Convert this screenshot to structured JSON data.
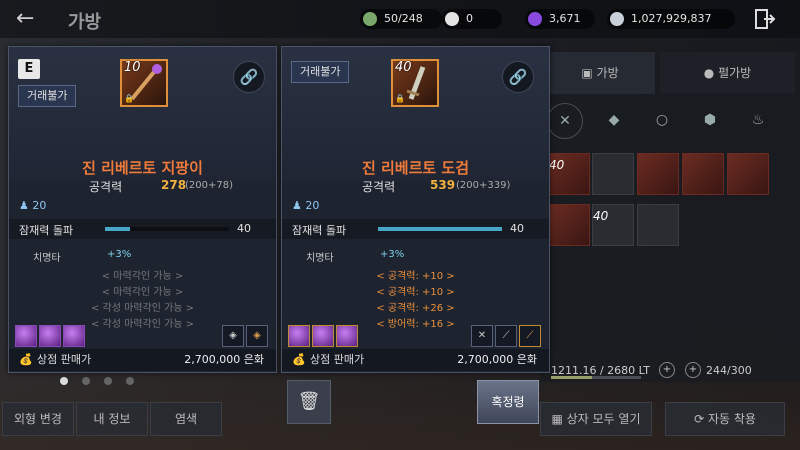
{
  "header": {
    "back": "←",
    "title": "가방"
  },
  "currencies": [
    {
      "value": "50/248",
      "color": "#7aa86a"
    },
    {
      "value": "0",
      "color": "#e4e4e4"
    },
    {
      "value": "3,671",
      "color": "#8a4ae0"
    },
    {
      "value": "1,027,929,837",
      "color": "#c8d0da"
    }
  ],
  "right_panel": {
    "tabs": [
      "가방",
      "펄가방"
    ],
    "weight": "1211.16 / 2680 LT",
    "slots": "244/300",
    "open_all": "상자 모두 열기",
    "auto_equip": "자동 착용",
    "slot_labels": [
      "40",
      "40"
    ]
  },
  "bottom_buttons": [
    "외형 변경",
    "내 정보",
    "염색"
  ],
  "card_left": {
    "badge": "E",
    "trade": "거래불가",
    "enhance": "10",
    "name": "진 리베르토 지팡이",
    "atk_label": "공격력",
    "atk_value": "278",
    "atk_detail": "(200+78)",
    "level": "20",
    "potential_label": "잠재력 돌파",
    "potential_value": "40",
    "potential_ratio": 0.2,
    "crit_label": "치명타",
    "crit_value": "+3%",
    "empty_lines": [
      "< 마력각인 가능 >",
      "< 마력각인 가능 >",
      "< 각성 마력각인 가능 >",
      "< 각성 마력각인 가능 >"
    ],
    "price_label": "상점 판매가",
    "price_value": "2,700,000 은화"
  },
  "card_right": {
    "trade": "거래불가",
    "enhance": "40",
    "name": "진 리베르토 도검",
    "atk_label": "공격력",
    "atk_value": "539",
    "atk_detail": "(200+339)",
    "level": "20",
    "potential_label": "잠재력 돌파",
    "potential_value": "40",
    "potential_ratio": 1.0,
    "crit_label": "치명타",
    "crit_value": "+3%",
    "bonus_lines": [
      "< 공격력: +10 >",
      "< 공격력: +10 >",
      "< 공격력: +26 >",
      "< 방어력: +16 >"
    ],
    "price_label": "상점 판매가",
    "price_value": "2,700,000 은화"
  },
  "actions": {
    "delete": "🗑",
    "tune": "혹정령"
  },
  "colors": {
    "item_name": "#f07a3a",
    "atk_value": "#f0b040",
    "bonus": "#e8903a",
    "potential_fill": "#48a6c8"
  }
}
